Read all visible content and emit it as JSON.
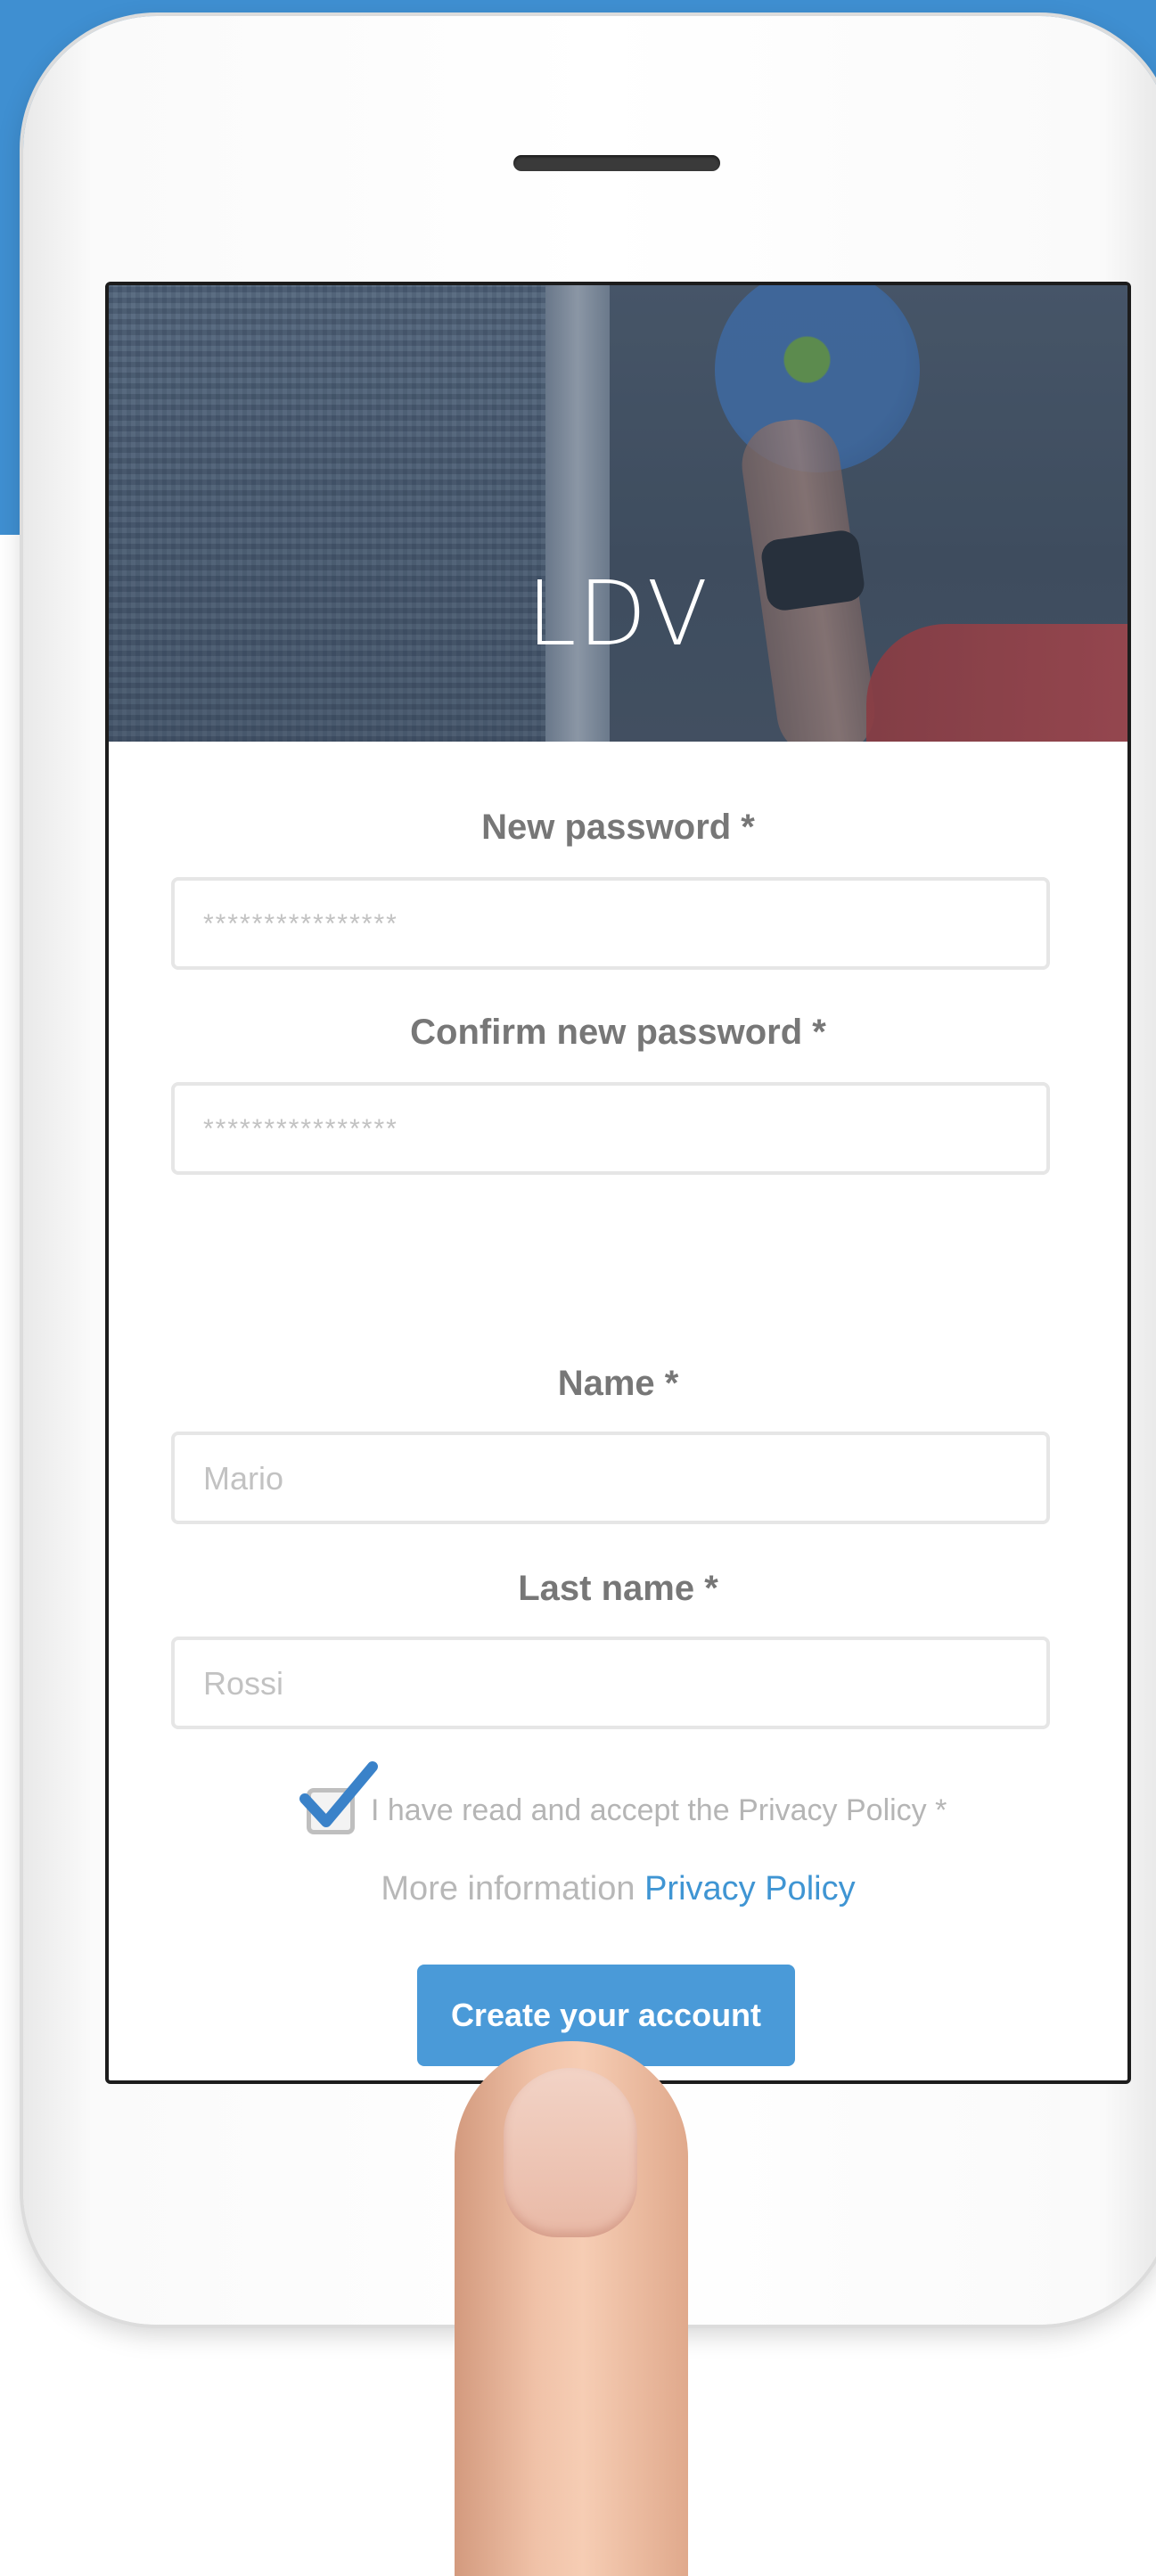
{
  "app": {
    "logo_text": "LDV"
  },
  "form": {
    "new_password_label": "New password *",
    "new_password_placeholder": "****************",
    "confirm_password_label": "Confirm new password  *",
    "confirm_password_placeholder": "****************",
    "name_label": "Name *",
    "name_placeholder": "Mario",
    "last_name_label": "Last name *",
    "last_name_placeholder": "Rossi",
    "privacy_checkbox_label": "I have read and accept the Privacy Policy *",
    "privacy_checked": true,
    "more_info_text": "More information ",
    "privacy_link_text": "Privacy Policy",
    "submit_label": "Create your account"
  },
  "colors": {
    "accent": "#4a9ad8",
    "background_band": "#3f8fd1",
    "label": "#777777",
    "checkmark": "#3a82c9"
  }
}
